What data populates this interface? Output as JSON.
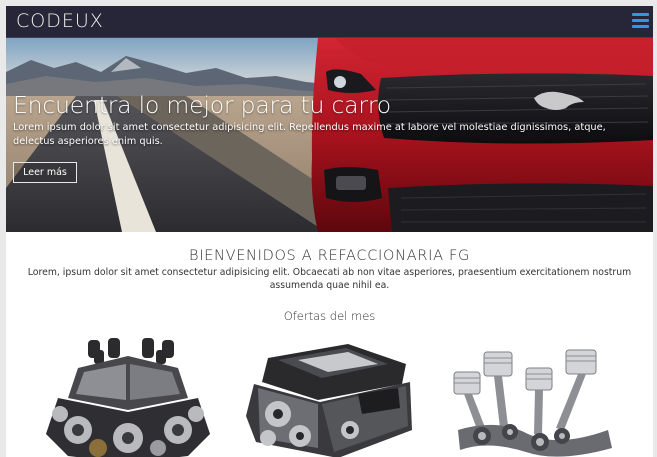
{
  "navbar": {
    "brand": "CODEUX",
    "menu_icon": "hamburger-menu-icon",
    "menu_color": "#2f95e8",
    "background": "#262638"
  },
  "hero": {
    "title": "Encuentra lo mejor para tu carro",
    "text": "Lorem ipsum dolor sit amet consectetur adipisicing elit. Repellendus maxime at labore vel molestiae dignissimos, atque, delectus asperiores enim quis.",
    "button_label": "Leer más",
    "car_color": "#b3141f"
  },
  "welcome": {
    "title": "BIENVENIDOS A REFACCIONARIA FG",
    "text": "Lorem, ipsum dolor sit amet consectetur adipisicing elit. Obcaecati ab non vitae asperiores, praesentium exercitationem nostrum assumenda quae nihil ea."
  },
  "offers": {
    "title": "Ofertas del mes",
    "products": [
      {
        "image": "v8-engine-image"
      },
      {
        "image": "car-engine-image"
      },
      {
        "image": "pistons-image"
      }
    ]
  }
}
